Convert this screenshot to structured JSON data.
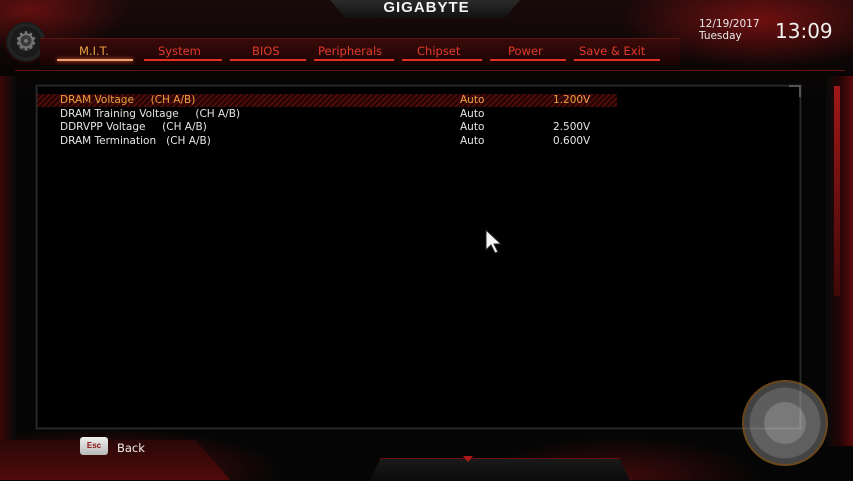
{
  "header": {
    "brand": "GIGABYTE",
    "date": "12/19/2017",
    "weekday": "Tuesday",
    "time": "13:09"
  },
  "tabs": [
    {
      "label": "M.I.T.",
      "active": true
    },
    {
      "label": "System",
      "active": false
    },
    {
      "label": "BIOS",
      "active": false
    },
    {
      "label": "Peripherals",
      "active": false
    },
    {
      "label": "Chipset",
      "active": false
    },
    {
      "label": "Power",
      "active": false
    },
    {
      "label": "Save & Exit",
      "active": false
    }
  ],
  "settings": [
    {
      "name": "DRAM Voltage     (CH A/B)",
      "mode": "Auto",
      "value": "1.200V",
      "selected": true
    },
    {
      "name": "DRAM Training Voltage     (CH A/B)",
      "mode": "Auto",
      "value": "",
      "selected": false
    },
    {
      "name": "DDRVPP Voltage     (CH A/B)",
      "mode": "Auto",
      "value": "2.500V",
      "selected": false
    },
    {
      "name": "DRAM Termination   (CH A/B)",
      "mode": "Auto",
      "value": "0.600V",
      "selected": false
    }
  ],
  "footer": {
    "esc_key": "Esc",
    "back_label": "Back"
  },
  "colors": {
    "accent_red": "#e23a2a",
    "active_orange": "#e8a040",
    "selected_text": "#f0a040"
  },
  "icons": {
    "gear": "gear-icon",
    "cursor": "mouse-pointer-icon"
  }
}
